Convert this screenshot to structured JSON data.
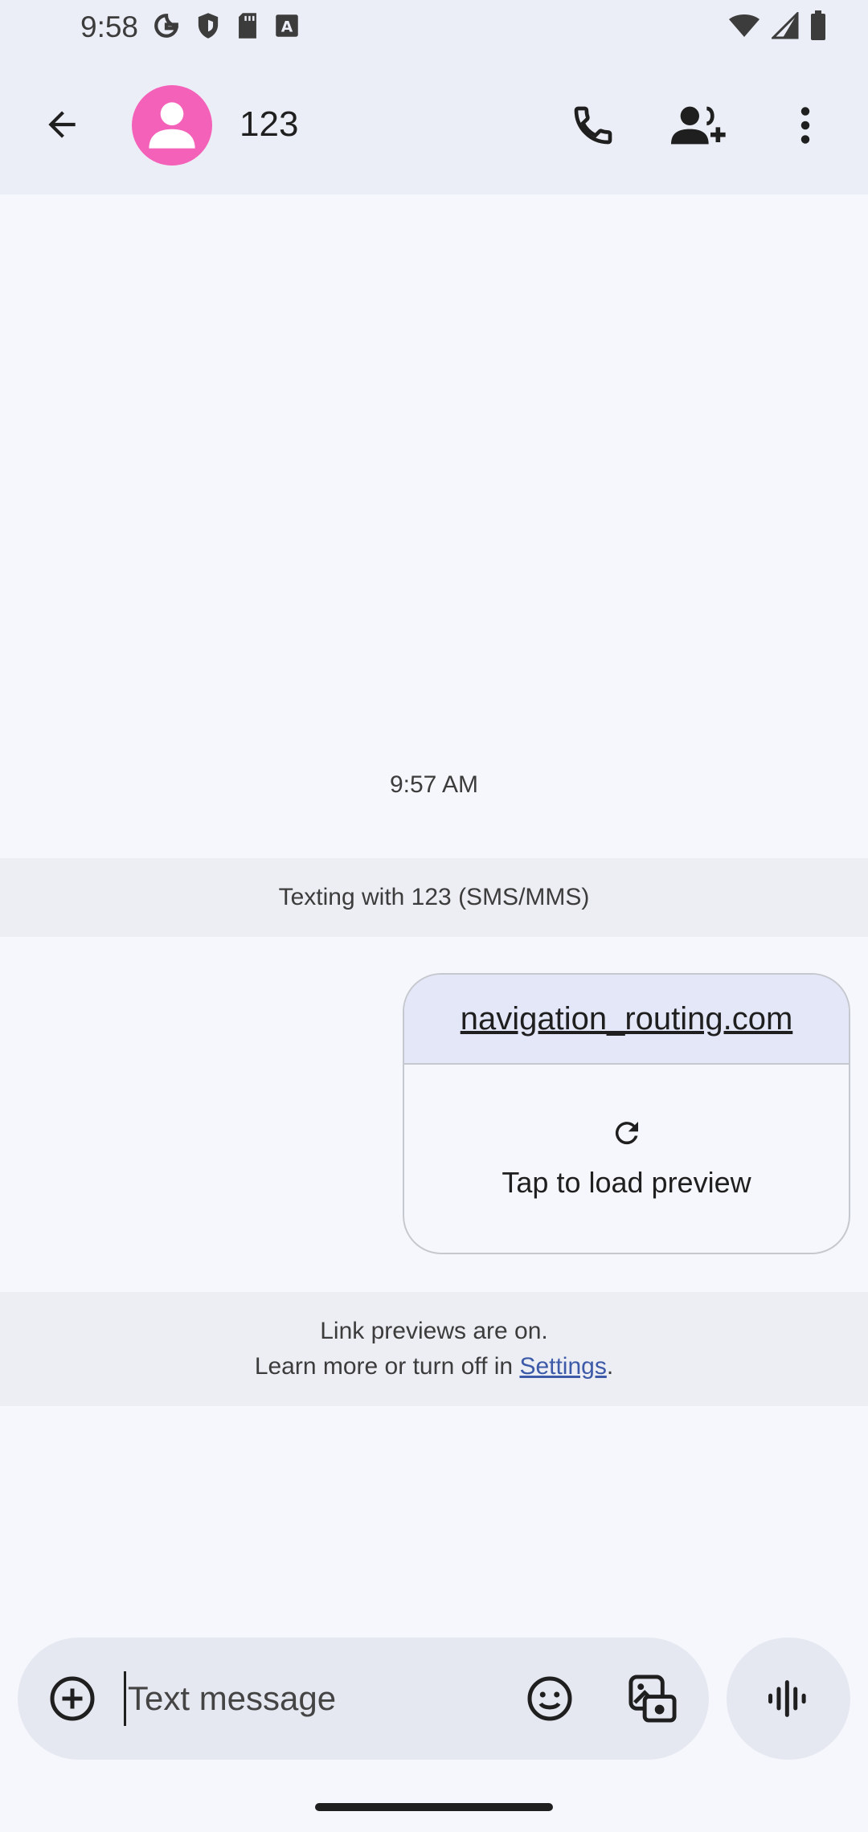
{
  "status_bar": {
    "time": "9:58",
    "left_icons": [
      "google-icon",
      "shield-icon",
      "sd-card-icon",
      "font-a-icon"
    ],
    "right_icons": [
      "wifi-icon",
      "signal-icon",
      "battery-icon"
    ]
  },
  "header": {
    "contact_name": "123",
    "avatar_color": "#f361b8",
    "actions": [
      "call-icon",
      "add-contact-icon",
      "more-icon"
    ]
  },
  "thread": {
    "timestamp": "9:57 AM",
    "texting_banner": "Texting with 123 (SMS/MMS)",
    "message": {
      "link_text": "navigation_routing.com",
      "preview_label": "Tap to load preview"
    },
    "link_notice": {
      "line1": "Link previews are on.",
      "line2_prefix": "Learn more or turn off in ",
      "settings_link": "Settings",
      "line2_suffix": "."
    }
  },
  "compose": {
    "placeholder": "Text message"
  },
  "colors": {
    "accent": "#3c5aa8",
    "surface": "#eceef7",
    "background": "#f6f7fc"
  }
}
